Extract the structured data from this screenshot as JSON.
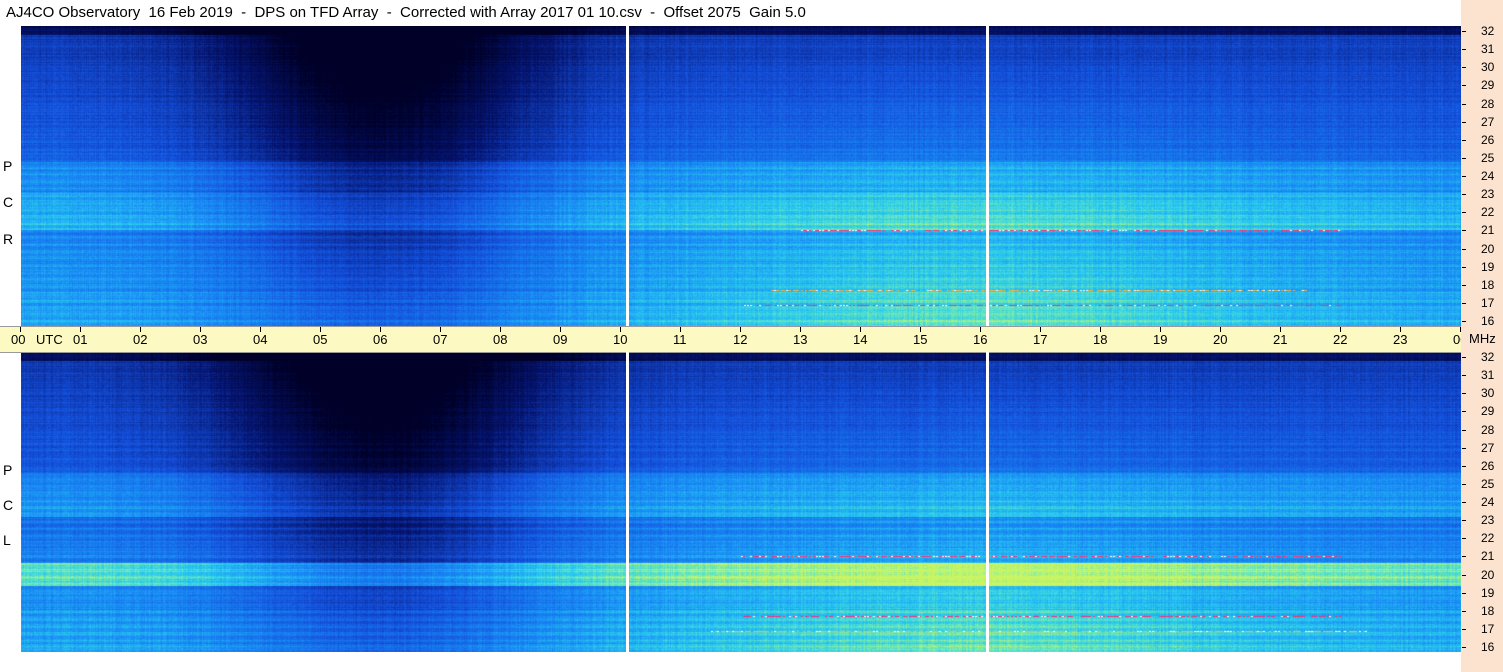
{
  "title": "AJ4CO Observatory  16 Feb 2019  -  DPS on TFD Array  -  Corrected with Array 2017 01 10.csv  -  Offset 2075  Gain 5.0",
  "panels": [
    {
      "name": "rcp",
      "letters": [
        "R",
        "C",
        "P"
      ]
    },
    {
      "name": "lcp",
      "letters": [
        "L",
        "C",
        "P"
      ]
    }
  ],
  "chart_data": {
    "type": "heatmap",
    "x_axis": {
      "label": "UTC",
      "tick_labels": [
        "00",
        "01",
        "02",
        "03",
        "04",
        "05",
        "06",
        "07",
        "08",
        "09",
        "10",
        "11",
        "12",
        "13",
        "14",
        "15",
        "16",
        "17",
        "18",
        "19",
        "20",
        "21",
        "22",
        "23",
        "00"
      ],
      "range_hours": [
        0,
        24
      ]
    },
    "y_axis": {
      "label": "MHz",
      "tick_labels": [
        "16",
        "17",
        "18",
        "19",
        "20",
        "21",
        "22",
        "23",
        "24",
        "25",
        "26",
        "27",
        "28",
        "29",
        "30",
        "31",
        "32"
      ],
      "range_mhz": [
        16,
        32
      ]
    },
    "series": [
      {
        "name": "RCP"
      },
      {
        "name": "LCP"
      }
    ],
    "marker_times_utc": [
      10.1,
      16.1
    ],
    "colors": {
      "low": "#00003a",
      "mid": "#1a5ee6",
      "high": "#28d8f0",
      "peak": "#b8f56a",
      "burst": "#ff3070"
    }
  }
}
